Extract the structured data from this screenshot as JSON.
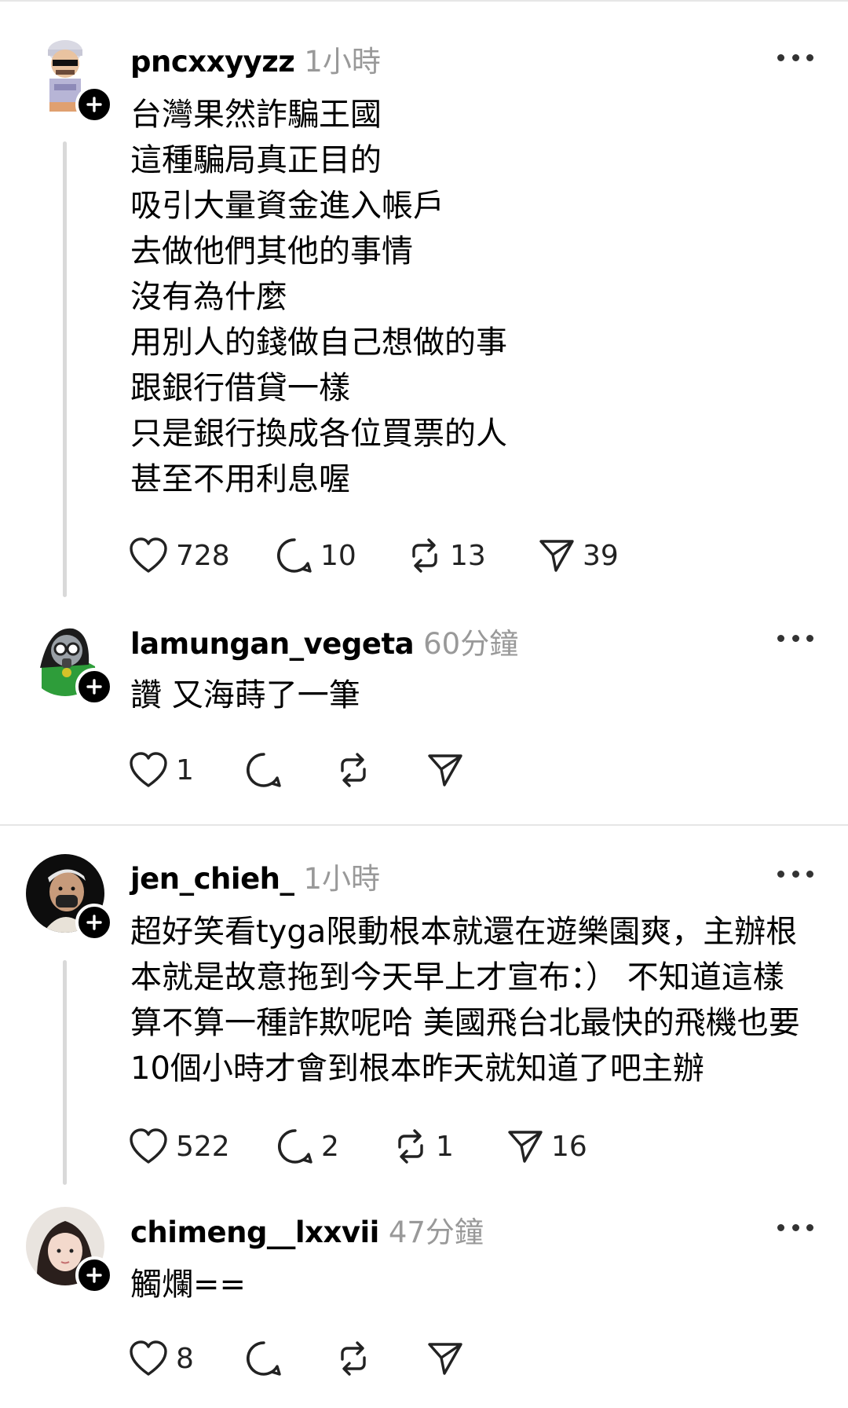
{
  "posts": [
    {
      "username": "pncxxyyzz",
      "time": "1小時",
      "lines": [
        "台灣果然詐騙王國",
        "這種騙局真正目的",
        "吸引大量資金進入帳戶",
        "去做他們其他的事情",
        "沒有為什麼",
        "用別人的錢做自己想做的事",
        "跟銀行借貸一樣",
        "只是銀行換成各位買票的人",
        "甚至不用利息喔"
      ],
      "likes": "728",
      "replies": "10",
      "reposts": "13",
      "shares": "39"
    },
    {
      "username": "lamungan_vegeta",
      "time": "60分鐘",
      "lines": [
        "讚 又海蒔了一筆"
      ],
      "likes": "1",
      "replies": "",
      "reposts": "",
      "shares": ""
    },
    {
      "username": "jen_chieh_",
      "time": "1小時",
      "lines": [
        "超好笑看tyga限動根本就還在遊樂園爽，主辦根",
        "本就是故意拖到今天早上才宣布：） 不知道這樣",
        "算不算一種詐欺呢哈 美國飛台北最快的飛機也要",
        "10個小時才會到根本昨天就知道了吧主辦"
      ],
      "likes": "522",
      "replies": "2",
      "reposts": "1",
      "shares": "16"
    },
    {
      "username": "chimeng__lxxvii",
      "time": "47分鐘",
      "lines": [
        "觸爛=="
      ],
      "likes": "8",
      "replies": "",
      "reposts": "",
      "shares": ""
    }
  ],
  "icons": {
    "like": "heart-icon",
    "reply": "comment-icon",
    "repost": "repost-icon",
    "share": "send-icon",
    "more": "more-icon",
    "follow": "plus-icon"
  },
  "colors": {
    "text": "#000000",
    "secondary": "#999999",
    "divider": "#e6e6e6",
    "thread_line": "#d9d9d9"
  }
}
